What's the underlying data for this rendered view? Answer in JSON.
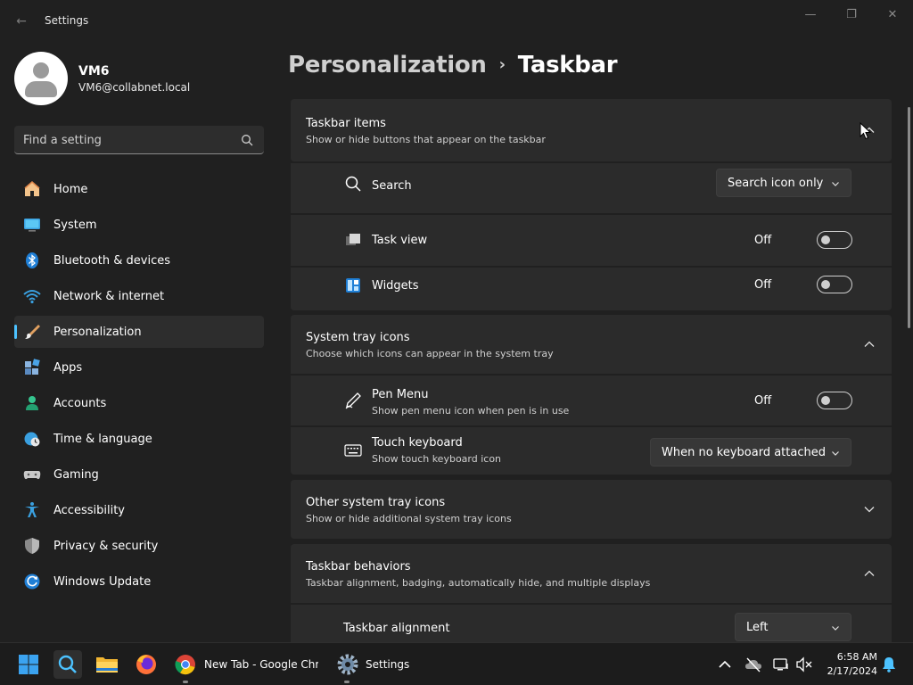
{
  "window": {
    "title": "Settings",
    "back_glyph": "←",
    "min_glyph": "—",
    "max_glyph": "❐",
    "close_glyph": "✕"
  },
  "user": {
    "name": "VM6",
    "email": "VM6@collabnet.local"
  },
  "search": {
    "placeholder": "Find a setting"
  },
  "nav": {
    "items": [
      {
        "label": "Home",
        "icon": "home-icon"
      },
      {
        "label": "System",
        "icon": "system-icon"
      },
      {
        "label": "Bluetooth & devices",
        "icon": "bluetooth-icon"
      },
      {
        "label": "Network & internet",
        "icon": "network-icon"
      },
      {
        "label": "Personalization",
        "icon": "brush-icon",
        "active": true
      },
      {
        "label": "Apps",
        "icon": "apps-icon"
      },
      {
        "label": "Accounts",
        "icon": "accounts-icon"
      },
      {
        "label": "Time & language",
        "icon": "clock-globe-icon"
      },
      {
        "label": "Gaming",
        "icon": "gamepad-icon"
      },
      {
        "label": "Accessibility",
        "icon": "accessibility-icon"
      },
      {
        "label": "Privacy & security",
        "icon": "shield-icon"
      },
      {
        "label": "Windows Update",
        "icon": "update-icon"
      }
    ]
  },
  "header": {
    "parent": "Personalization",
    "separator": "›",
    "current": "Taskbar"
  },
  "sections": {
    "taskbar_items": {
      "title": "Taskbar items",
      "desc": "Show or hide buttons that appear on the taskbar",
      "rows": {
        "search": {
          "label": "Search",
          "value": "Search icon only"
        },
        "task_view": {
          "label": "Task view",
          "state": "Off"
        },
        "widgets": {
          "label": "Widgets",
          "state": "Off"
        }
      }
    },
    "system_tray": {
      "title": "System tray icons",
      "desc": "Choose which icons can appear in the system tray",
      "rows": {
        "pen_menu": {
          "label": "Pen Menu",
          "sub": "Show pen menu icon when pen is in use",
          "state": "Off"
        },
        "touch_keyboard": {
          "label": "Touch keyboard",
          "sub": "Show touch keyboard icon",
          "value": "When no keyboard attached"
        }
      }
    },
    "other_tray": {
      "title": "Other system tray icons",
      "desc": "Show or hide additional system tray icons"
    },
    "behaviors": {
      "title": "Taskbar behaviors",
      "desc": "Taskbar alignment, badging, automatically hide, and multiple displays",
      "rows": {
        "alignment": {
          "label": "Taskbar alignment",
          "value": "Left"
        }
      }
    }
  },
  "taskbar": {
    "apps": [
      {
        "name": "start-button"
      },
      {
        "name": "search-button"
      },
      {
        "name": "file-explorer"
      },
      {
        "name": "firefox"
      },
      {
        "name": "chrome",
        "label": "New Tab - Google Chrome"
      },
      {
        "name": "settings",
        "label": "Settings"
      }
    ],
    "clock": {
      "time": "6:58 AM",
      "date": "2/17/2024"
    }
  },
  "colors": {
    "accent": "#4cc2ff",
    "background": "#202020",
    "card": "#2b2b2b",
    "taskbar": "#1c1c1c"
  }
}
